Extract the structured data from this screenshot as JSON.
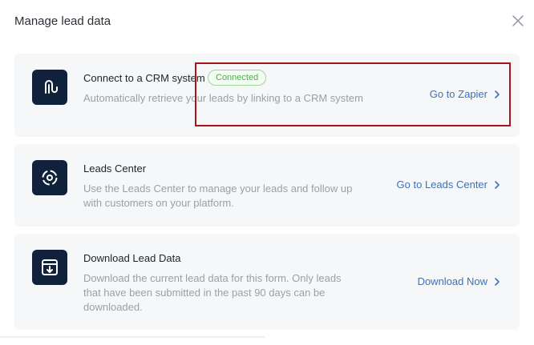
{
  "dialog": {
    "title": "Manage lead data",
    "close_icon": "close-icon"
  },
  "cards": [
    {
      "icon": "crm-link-icon",
      "title": "Connect to a CRM system",
      "badge": "Connected",
      "description": "Automatically retrieve your leads by linking to a CRM system",
      "action": "Go to Zapier"
    },
    {
      "icon": "leads-center-icon",
      "title": "Leads Center",
      "description": "Use the Leads Center to manage your leads and follow up with customers on your platform.",
      "action": "Go to Leads Center"
    },
    {
      "icon": "download-box-icon",
      "title": "Download Lead Data",
      "description": "Download the current lead data for this form. Only leads that have been submitted in the past 90 days can be downloaded.",
      "action": "Download Now"
    }
  ],
  "colors": {
    "icon_bg": "#10213c",
    "link": "#3d72b5",
    "badge_green": "#4caf50",
    "highlight": "#a5161b"
  }
}
